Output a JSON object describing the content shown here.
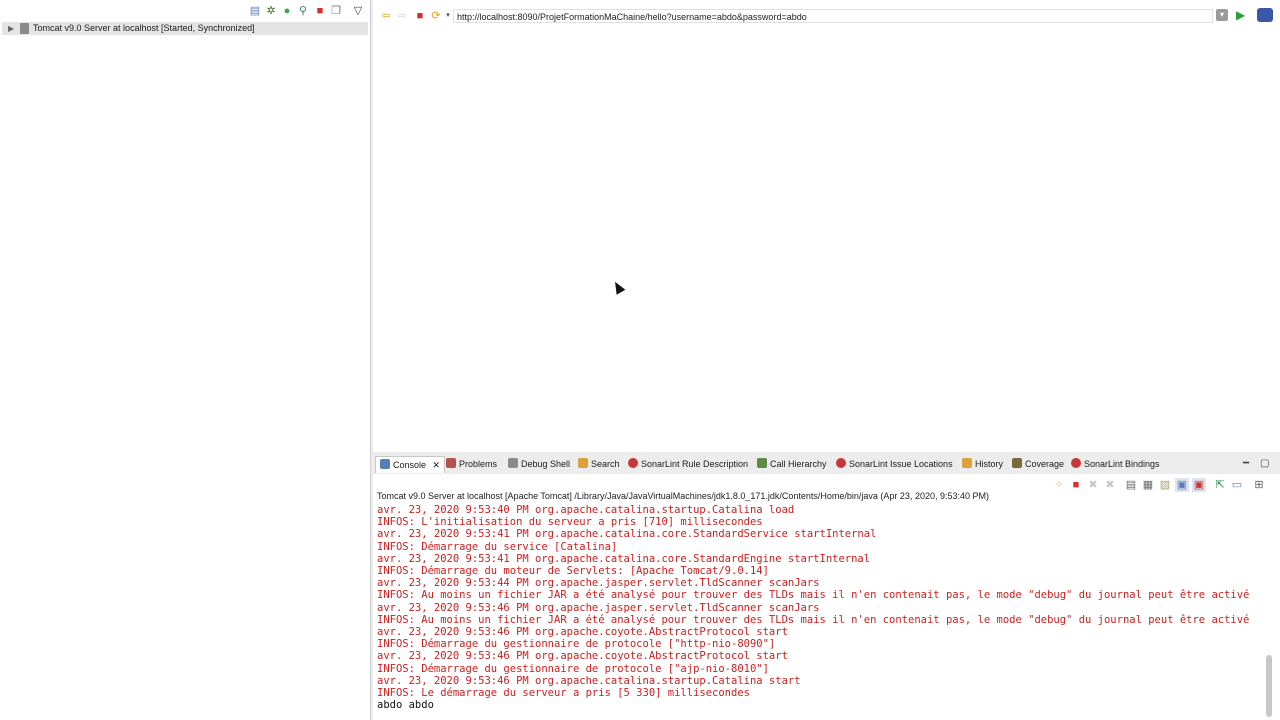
{
  "servers": {
    "toolbar_icons": [
      "collapse-icon",
      "debug-icon",
      "start-icon",
      "profile-icon",
      "stop-icon",
      "publish-icon",
      "view-menu-icon"
    ],
    "server_label": "Tomcat v9.0 Server at localhost  [Started, Synchronized]"
  },
  "browser": {
    "url": "http://localhost:8090/ProjetFormationMaChaine/hello?username=abdo&password=abdo"
  },
  "console": {
    "tabs": [
      {
        "label": "Console",
        "icon": "console-icon",
        "active": true
      },
      {
        "label": "Problems",
        "icon": "problems-icon"
      },
      {
        "label": "Debug Shell",
        "icon": "debug-shell-icon"
      },
      {
        "label": "Search",
        "icon": "search-icon"
      },
      {
        "label": "SonarLint Rule Description",
        "icon": "sonarlint-icon"
      },
      {
        "label": "Call Hierarchy",
        "icon": "call-hierarchy-icon"
      },
      {
        "label": "SonarLint Issue Locations",
        "icon": "sonarlint-icon"
      },
      {
        "label": "History",
        "icon": "history-icon"
      },
      {
        "label": "Coverage",
        "icon": "coverage-icon"
      },
      {
        "label": "SonarLint Bindings",
        "icon": "sonarlint-icon"
      }
    ],
    "header": "Tomcat v9.0 Server at localhost [Apache Tomcat] /Library/Java/JavaVirtualMachines/jdk1.8.0_171.jdk/Contents/Home/bin/java (Apr 23, 2020, 9:53:40 PM)",
    "lines": [
      "avr. 23, 2020 9:53:40 PM org.apache.catalina.startup.Catalina load",
      "INFOS: L'initialisation du serveur a pris [710] millisecondes",
      "avr. 23, 2020 9:53:41 PM org.apache.catalina.core.StandardService startInternal",
      "INFOS: Démarrage du service [Catalina]",
      "avr. 23, 2020 9:53:41 PM org.apache.catalina.core.StandardEngine startInternal",
      "INFOS: Démarrage du moteur de Servlets: [Apache Tomcat/9.0.14]",
      "avr. 23, 2020 9:53:44 PM org.apache.jasper.servlet.TldScanner scanJars",
      "INFOS: Au moins un fichier JAR a été analysé pour trouver des TLDs mais il n'en contenait pas, le mode \"debug\" du journal peut être activé",
      "avr. 23, 2020 9:53:46 PM org.apache.jasper.servlet.TldScanner scanJars",
      "INFOS: Au moins un fichier JAR a été analysé pour trouver des TLDs mais il n'en contenait pas, le mode \"debug\" du journal peut être activé",
      "avr. 23, 2020 9:53:46 PM org.apache.coyote.AbstractProtocol start",
      "INFOS: Démarrage du gestionnaire de protocole [\"http-nio-8090\"]",
      "avr. 23, 2020 9:53:46 PM org.apache.coyote.AbstractProtocol start",
      "INFOS: Démarrage du gestionnaire de protocole [\"ajp-nio-8010\"]",
      "avr. 23, 2020 9:53:46 PM org.apache.catalina.startup.Catalina start",
      "INFOS: Le démarrage du serveur a pris [5 330] millisecondes"
    ],
    "output_line": "abdo abdo"
  }
}
